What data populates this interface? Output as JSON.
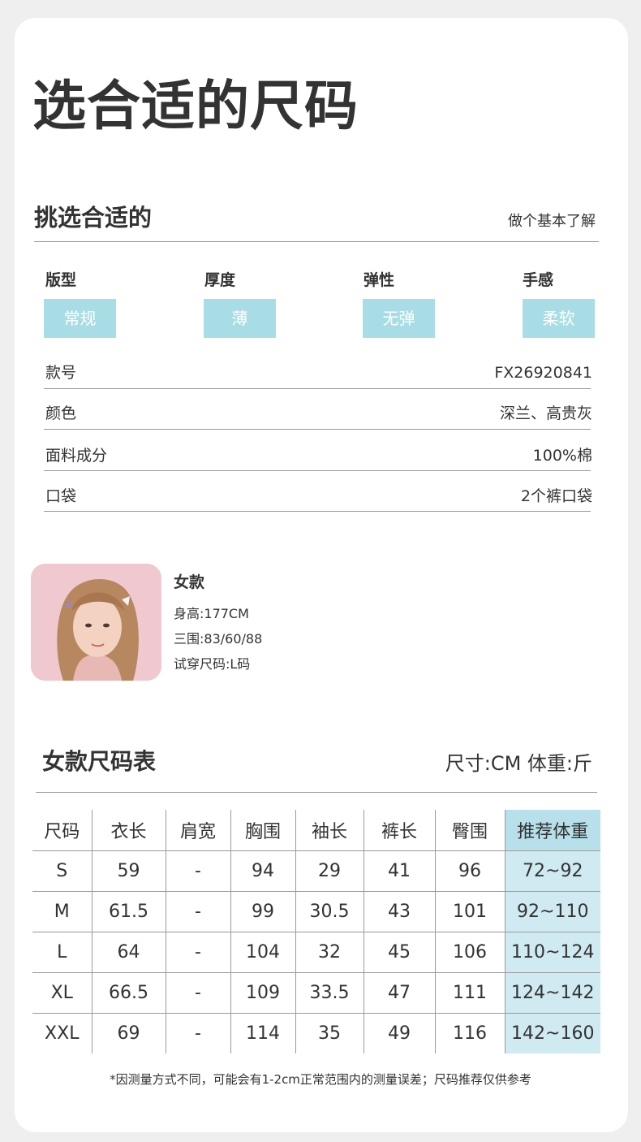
{
  "header": {
    "title": "选合适的尺码"
  },
  "section": {
    "title": "挑选合适的",
    "subtitle": "做个基本了解"
  },
  "attributes": [
    {
      "label": "版型",
      "value": "常规"
    },
    {
      "label": "厚度",
      "value": "薄"
    },
    {
      "label": "弹性",
      "value": "无弹"
    },
    {
      "label": "手感",
      "value": "柔软"
    }
  ],
  "specs": [
    {
      "key": "款号",
      "value": "FX26920841"
    },
    {
      "key": "颜色",
      "value": "深兰、高贵灰"
    },
    {
      "key": "面料成分",
      "value": "100%棉"
    },
    {
      "key": "口袋",
      "value": "2个裤口袋"
    }
  ],
  "model": {
    "title": "女款",
    "height": "身高:177CM",
    "measurements": "三围:83/60/88",
    "size": "试穿尺码:L码"
  },
  "size_table": {
    "title": "女款尺码表",
    "unit": "尺寸:CM 体重:斤",
    "headers": [
      "尺码",
      "衣长",
      "肩宽",
      "胸围",
      "袖长",
      "裤长",
      "臀围",
      "推荐体重"
    ],
    "rows": [
      [
        "S",
        "59",
        "-",
        "94",
        "29",
        "41",
        "96",
        "72~92"
      ],
      [
        "M",
        "61.5",
        "-",
        "99",
        "30.5",
        "43",
        "101",
        "92~110"
      ],
      [
        "L",
        "64",
        "-",
        "104",
        "32",
        "45",
        "106",
        "110~124"
      ],
      [
        "XL",
        "66.5",
        "-",
        "109",
        "33.5",
        "47",
        "111",
        "124~142"
      ],
      [
        "XXL",
        "69",
        "-",
        "114",
        "35",
        "49",
        "116",
        "142~160"
      ]
    ]
  },
  "footnote": "*因测量方式不同，可能会有1-2cm正常范围内的测量误差；尺码推荐仅供参考",
  "colors": {
    "chip": "#a9dde5",
    "recommend_header": "#b7e0ea",
    "recommend_cell": "#cfeaf1"
  }
}
